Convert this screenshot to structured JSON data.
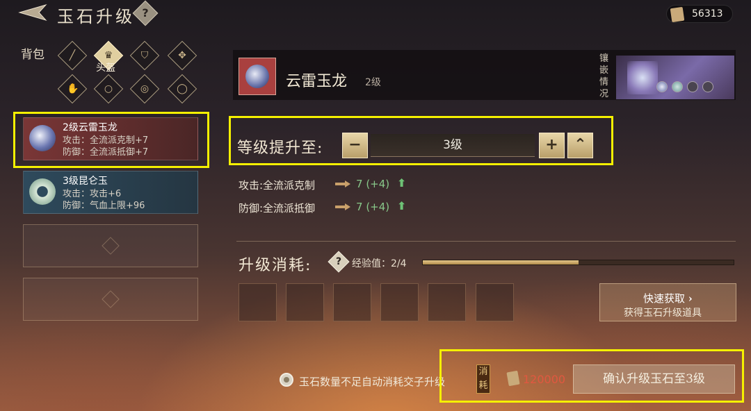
{
  "header": {
    "title": "玉石升级",
    "help": "?",
    "currency": "56313"
  },
  "tabs": {
    "bag": "背包",
    "selected": "头盔"
  },
  "list": [
    {
      "name": "2级云雷玉龙",
      "line1": "攻击：全流派克制+7",
      "line2": "防御：全流派抵御+7"
    },
    {
      "name": "3级昆仑玉",
      "line1": "攻击：攻击+6",
      "line2": "防御：气血上限+96"
    }
  ],
  "item": {
    "name": "云雷玉龙",
    "level": "2级",
    "inlay_label": "镶嵌情况"
  },
  "levelup": {
    "label": "等级提升至:",
    "minus": "−",
    "value": "3级",
    "plus": "+",
    "max": "⌃"
  },
  "stats": [
    {
      "label": "攻击:全流派克制",
      "value": "7",
      "bonus": "(+4)"
    },
    {
      "label": "防御:全流派抵御",
      "value": "7",
      "bonus": "(+4)"
    }
  ],
  "cost": {
    "title": "升级消耗:",
    "help": "?",
    "exp_label": "经验值：2/4",
    "exp_progress": 0.5
  },
  "quick": {
    "title": "快速获取",
    "sub": "获得玉石升级道具",
    "chevron": "›"
  },
  "bottom": {
    "auto_label": "玉石数量不足自动消耗交子升级",
    "cost_tag": "消耗",
    "amount": "120000",
    "confirm": "确认升级玉石至3级"
  }
}
